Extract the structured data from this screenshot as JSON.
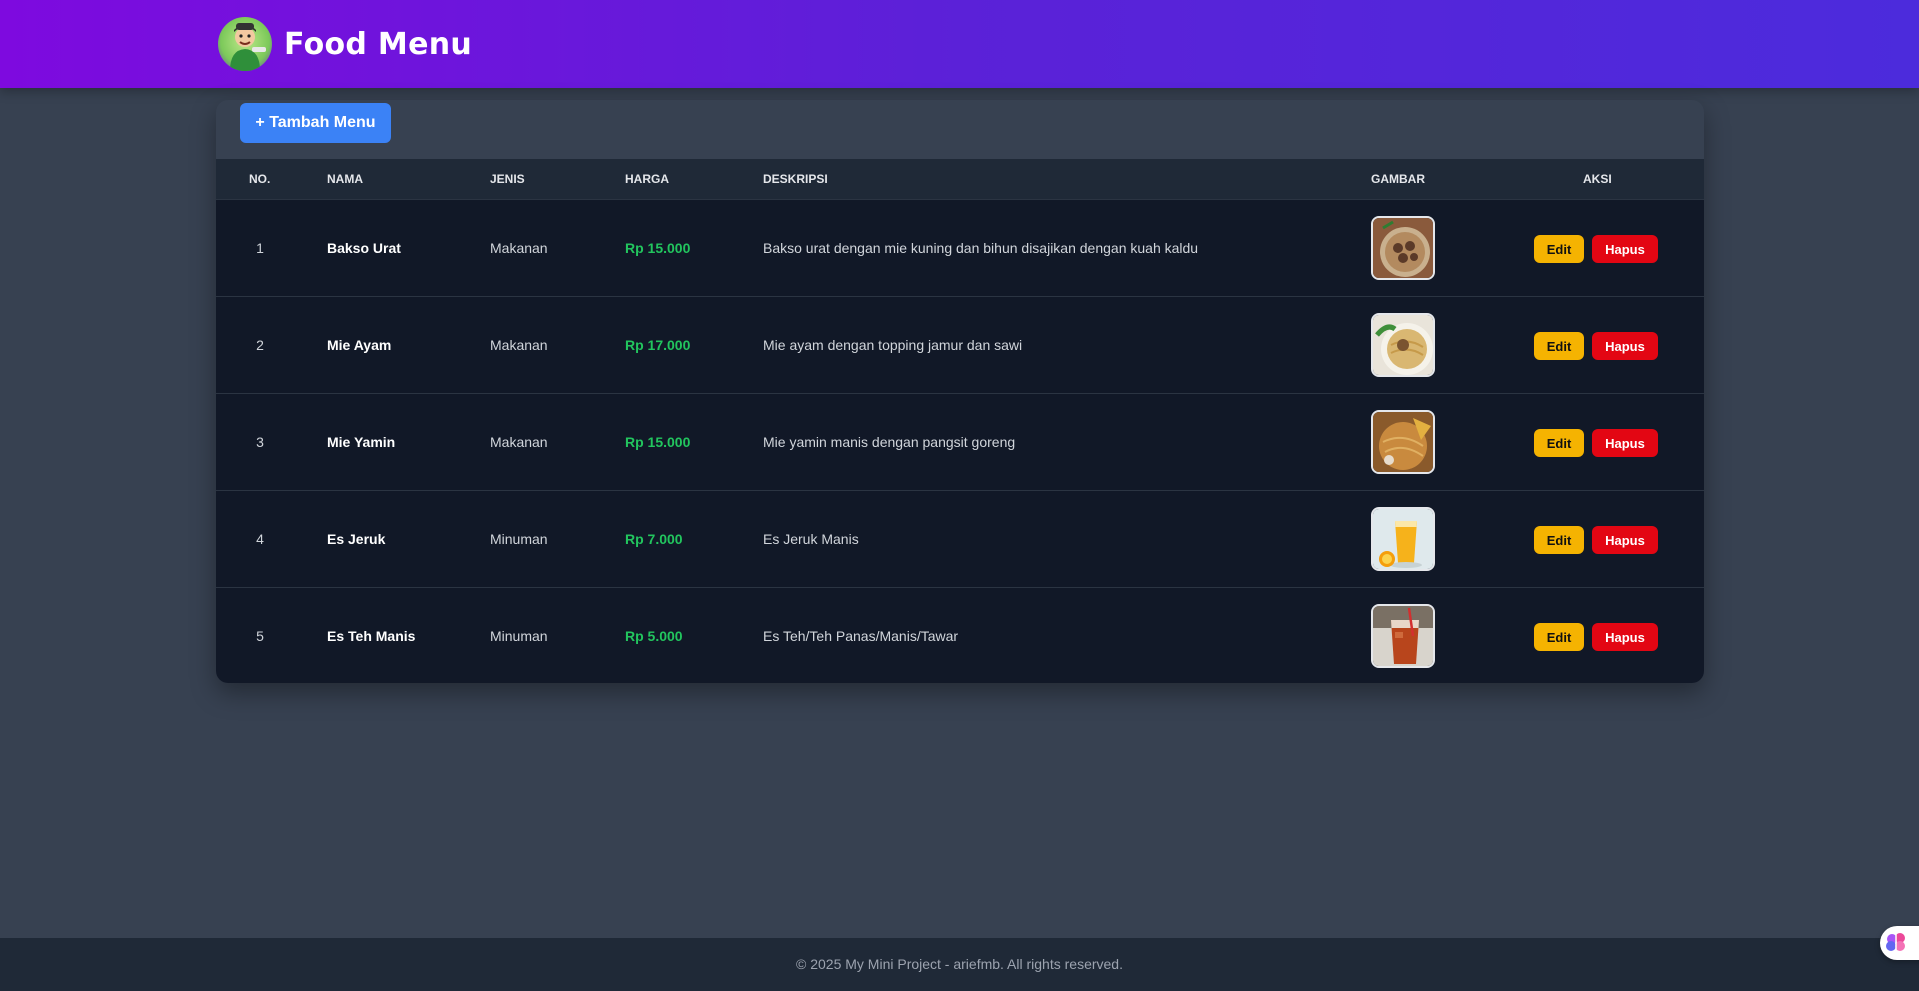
{
  "header": {
    "title": "Food Menu",
    "logo_icon": "chef-mascot-icon"
  },
  "toolbar": {
    "add_label": "+ Tambah Menu"
  },
  "table": {
    "columns": [
      "NO.",
      "NAMA",
      "JENIS",
      "HARGA",
      "DESKRIPSI",
      "GAMBAR",
      "AKSI"
    ],
    "rows": [
      {
        "no": "1",
        "name": "Bakso Urat",
        "type": "Makanan",
        "price": "Rp 15.000",
        "desc": "Bakso urat dengan mie kuning dan bihun disajikan dengan kuah kaldu",
        "image_icon": "bakso-photo"
      },
      {
        "no": "2",
        "name": "Mie Ayam",
        "type": "Makanan",
        "price": "Rp 17.000",
        "desc": "Mie ayam dengan topping jamur dan sawi",
        "image_icon": "mie-ayam-photo"
      },
      {
        "no": "3",
        "name": "Mie Yamin",
        "type": "Makanan",
        "price": "Rp 15.000",
        "desc": "Mie yamin manis dengan pangsit goreng",
        "image_icon": "mie-yamin-photo"
      },
      {
        "no": "4",
        "name": "Es Jeruk",
        "type": "Minuman",
        "price": "Rp 7.000",
        "desc": "Es Jeruk Manis",
        "image_icon": "es-jeruk-photo"
      },
      {
        "no": "5",
        "name": "Es Teh Manis",
        "type": "Minuman",
        "price": "Rp 5.000",
        "desc": "Es Teh/Teh Panas/Manis/Tawar",
        "image_icon": "es-teh-photo"
      }
    ],
    "edit_label": "Edit",
    "delete_label": "Hapus"
  },
  "footer": {
    "text": "© 2025 My Mini Project - ariefmb. All rights reserved."
  },
  "colors": {
    "header_start": "#7e0adf",
    "header_end": "#4c2bdc",
    "page_bg": "#374151",
    "row_bg": "#111827",
    "price": "#22c55e",
    "add_button": "#3b82f6",
    "edit_button": "#f5b301",
    "delete_button": "#e30613"
  }
}
